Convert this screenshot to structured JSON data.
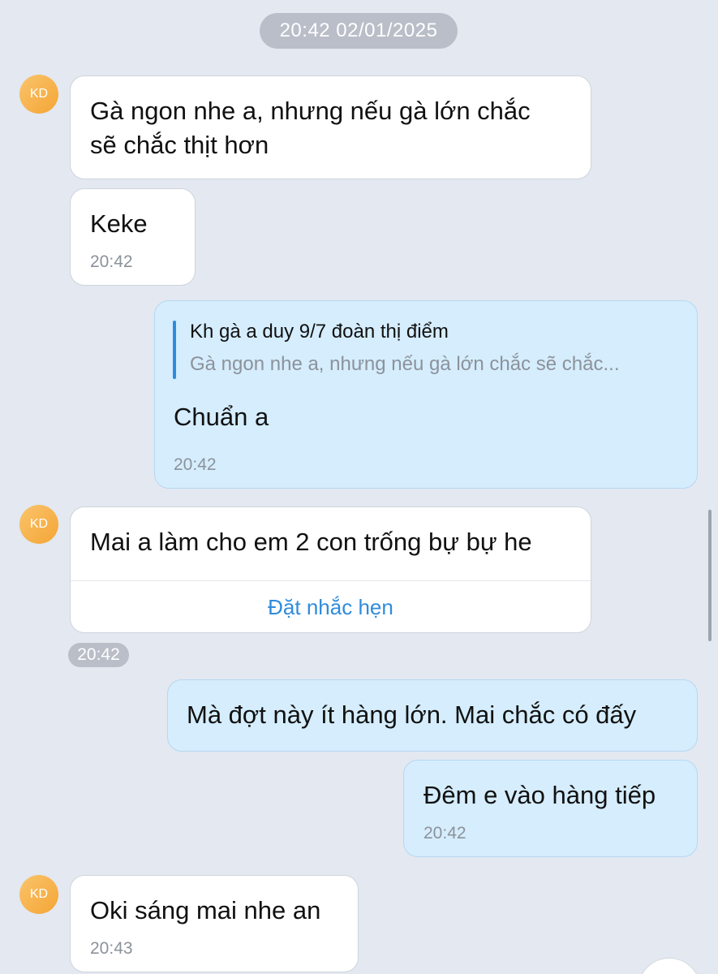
{
  "date_separator": "20:42 02/01/2025",
  "contact": {
    "initials": "KD"
  },
  "messages": [
    {
      "direction": "incoming",
      "line1": "Gà ngon nhe a, nhưng nếu gà lớn chắc",
      "line2": "sẽ chắc thịt hơn"
    },
    {
      "direction": "incoming",
      "text": "Keke",
      "time": "20:42"
    },
    {
      "direction": "outgoing",
      "quote": {
        "title": "Kh gà a duy 9/7 đoàn thị điểm",
        "text": "Gà ngon nhe a, nhưng nếu gà lớn chắc sẽ chắc..."
      },
      "text": "Chuẩn a",
      "time": "20:42"
    },
    {
      "direction": "incoming",
      "text": "Mai a làm cho em 2 con trống bự bự he",
      "action_label": "Đặt nhắc hẹn",
      "time": "20:42"
    },
    {
      "direction": "outgoing",
      "text": "Mà đợt này ít hàng lớn. Mai chắc có đấy"
    },
    {
      "direction": "outgoing",
      "text": "Đêm e vào hàng tiếp",
      "time": "20:42"
    },
    {
      "direction": "incoming",
      "text": "Oki sáng mai nhe an",
      "time": "20:43"
    }
  ],
  "colors": {
    "background": "#e3e8f1",
    "incoming_bubble": "#ffffff",
    "outgoing_bubble": "#d5edfd",
    "accent": "#2f8cdc",
    "avatar": "#f5a535"
  }
}
